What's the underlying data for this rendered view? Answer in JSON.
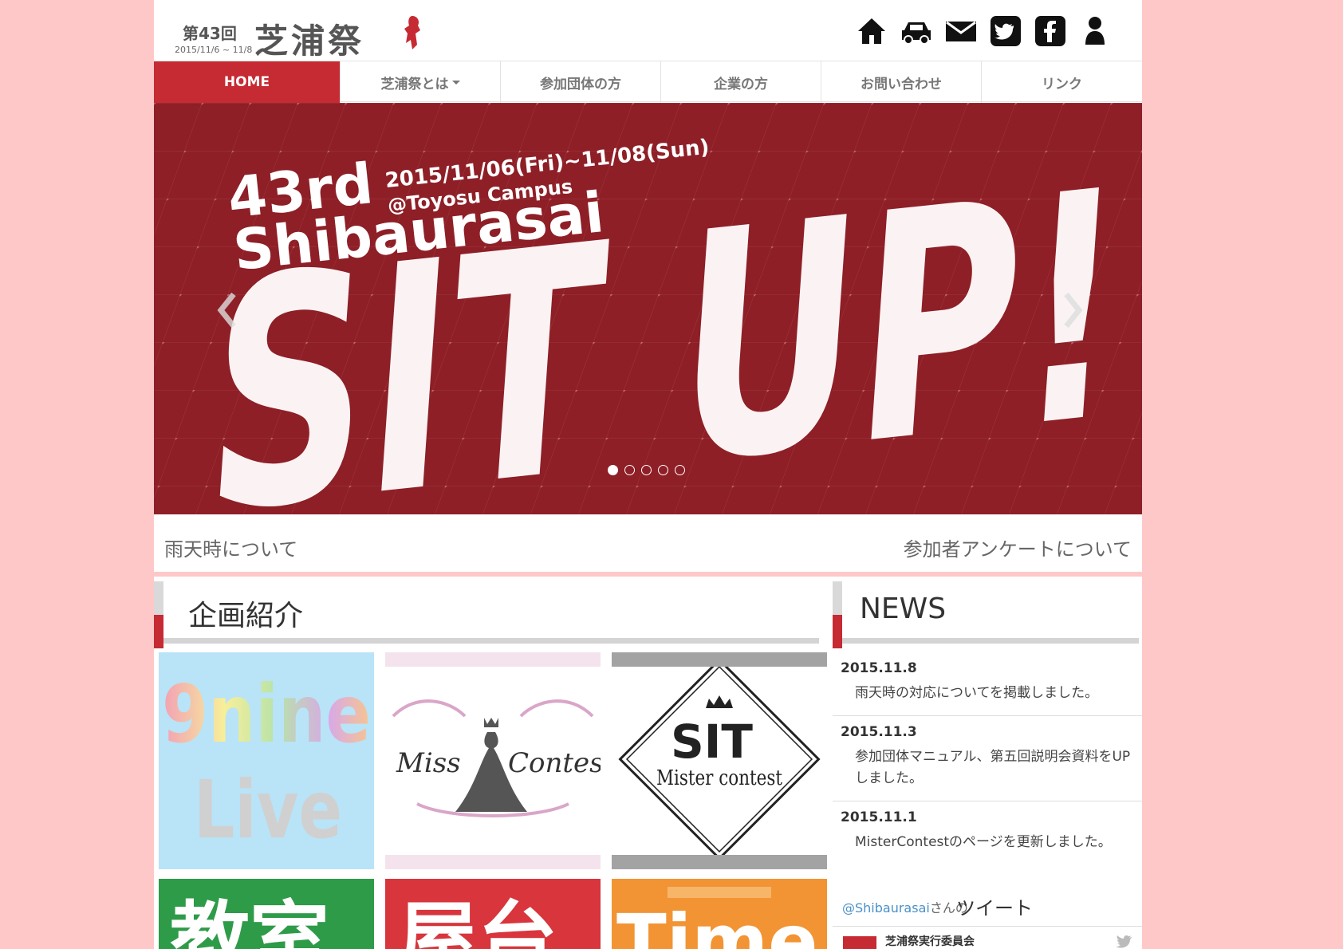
{
  "header": {
    "edition": "第43回",
    "name": "芝浦祭",
    "dates": "2015/11/6 ~ 11/8",
    "icons": [
      "home-icon",
      "car-icon",
      "mail-icon",
      "twitter-icon",
      "facebook-icon",
      "person-icon"
    ]
  },
  "nav": {
    "items": [
      {
        "label": "HOME"
      },
      {
        "label": "芝浦祭とは"
      },
      {
        "label": "参加団体の方"
      },
      {
        "label": "企業の方"
      },
      {
        "label": "お問い合わせ"
      },
      {
        "label": "リンク"
      }
    ]
  },
  "hero": {
    "date_line": "2015/11/06(Fri)~11/08(Sun)",
    "campus": "@Toyosu Campus",
    "edition": "43rd",
    "festival": "Shibaurasai",
    "slogan": "SIT UP!",
    "slide_count": 5,
    "active_slide": 1
  },
  "info": {
    "left_link": "雨天時について",
    "right_link": "参加者アンケートについて"
  },
  "projects": {
    "title": "企画紹介",
    "tiles": [
      {
        "line1": "9nine",
        "line2": "Live"
      },
      {
        "word1": "Miss",
        "word2": "Contest"
      },
      {
        "top": "SIT",
        "bottom": "Mister contest"
      },
      {
        "label": "教室"
      },
      {
        "label": "屋台"
      },
      {
        "label": "Time"
      }
    ]
  },
  "news": {
    "title": "NEWS",
    "entries": [
      {
        "date": "2015.11.8",
        "text": "雨天時の対応についてを掲載しました。"
      },
      {
        "date": "2015.11.3",
        "text": "参加団体マニュアル、第五回説明会資料をUPしました。"
      },
      {
        "date": "2015.11.1",
        "text": "MisterContestのページを更新しました。"
      }
    ]
  },
  "twitter": {
    "handle": "@Shibaurasai",
    "suffix": "さんの",
    "label": "ツイート",
    "account": "芝浦祭実行委員会"
  },
  "colors": {
    "accent": "#c62a33",
    "hero_bg": "#8e1f27",
    "page_bg": "#ffc8c8"
  }
}
